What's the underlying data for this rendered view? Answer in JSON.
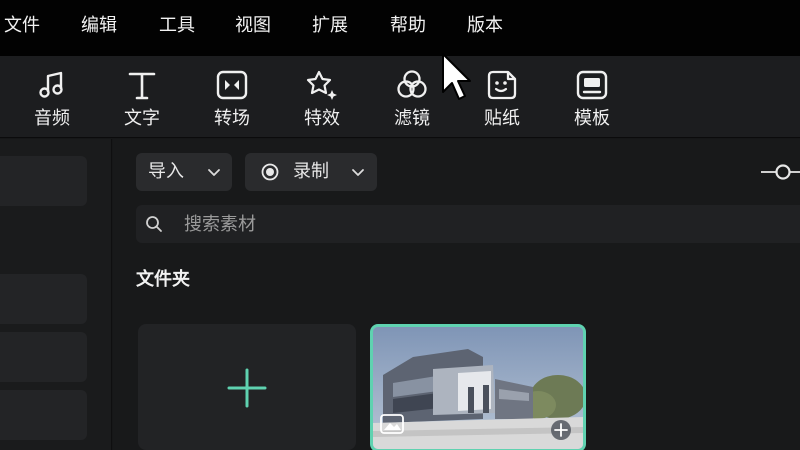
{
  "menu": {
    "items": [
      "文件",
      "编辑",
      "工具",
      "视图",
      "扩展",
      "帮助",
      "版本"
    ]
  },
  "toolbar": {
    "items": [
      {
        "label": "音频",
        "icon": "music-note-icon"
      },
      {
        "label": "文字",
        "icon": "text-t-icon"
      },
      {
        "label": "转场",
        "icon": "transition-icon"
      },
      {
        "label": "特效",
        "icon": "star-sparkle-icon"
      },
      {
        "label": "滤镜",
        "icon": "filter-circles-icon"
      },
      {
        "label": "贴纸",
        "icon": "sticker-icon"
      },
      {
        "label": "模板",
        "icon": "template-icon"
      }
    ]
  },
  "main": {
    "import_label": "导入",
    "record_label": "录制",
    "search_placeholder": "搜索素材",
    "folder_title": "文件夹"
  },
  "colors": {
    "accent": "#5fd2b0",
    "menubar_bg": "#020202",
    "toolbar_bg": "#1c1d1f",
    "panel_bg": "#18191a"
  }
}
